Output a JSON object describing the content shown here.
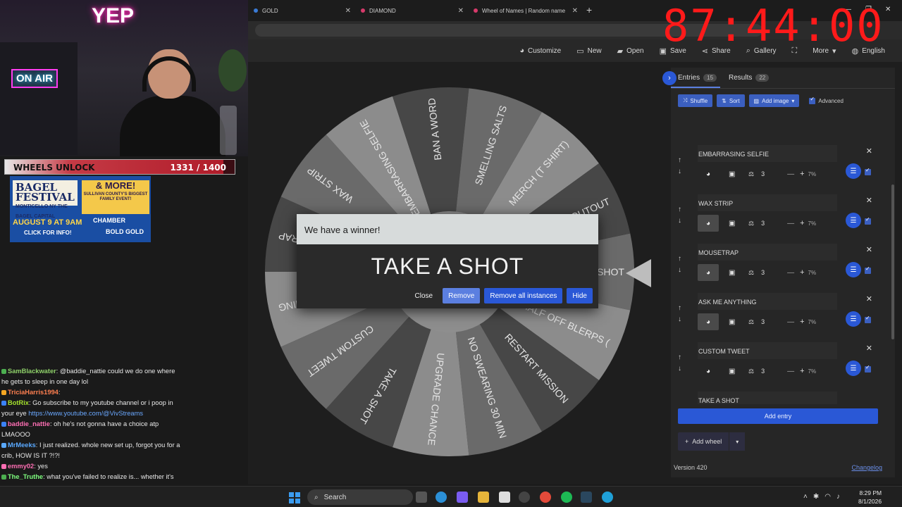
{
  "browser": {
    "tabs": [
      {
        "label": "GOLD",
        "color": "#3a7bd5"
      },
      {
        "label": "DIAMOND",
        "color": "#d73a6b"
      },
      {
        "label": "Wheel of Names | Random name",
        "color": "#d73a6b"
      }
    ],
    "new_tab": "+"
  },
  "timer": "87:44:00",
  "toolbar": {
    "customize": "Customize",
    "new": "New",
    "open": "Open",
    "save": "Save",
    "share": "Share",
    "gallery": "Gallery",
    "more": "More",
    "language": "English"
  },
  "wheel": {
    "segments": [
      "TAKE A SHOT",
      "HALF OFF BLERPS (",
      "RESTART MISSION",
      "NO SWEARING 30 MIN",
      "UPGRADE CHANCE",
      "TAKE A SHOT",
      "CUSTOM TWEET",
      "ASK ME ANYTHING",
      "MOUSETRAP",
      "WAX STRIP",
      "EMBARRASING SELFIE",
      "BAN A WORD",
      "SMELLING SALTS",
      "MERCH (T SHIRT)",
      "SHOUTOUT"
    ]
  },
  "modal": {
    "title": "We have a winner!",
    "winner": "TAKE A SHOT",
    "close": "Close",
    "remove": "Remove",
    "remove_all": "Remove all instances",
    "hide": "Hide"
  },
  "panel": {
    "tab_entries": "Entries",
    "entries_count": "15",
    "tab_results": "Results",
    "results_count": "22",
    "shuffle": "Shuffle",
    "sort": "Sort",
    "add_image": "Add image",
    "advanced": "Advanced",
    "entries": [
      {
        "name": "",
        "weight": "3",
        "pct": "7%"
      },
      {
        "name": "EMBARRASING SELFIE",
        "weight": "3",
        "pct": "7%"
      },
      {
        "name": "WAX STRIP",
        "weight": "3",
        "pct": "7%"
      },
      {
        "name": "MOUSETRAP",
        "weight": "3",
        "pct": "7%"
      },
      {
        "name": "ASK ME ANYTHING",
        "weight": "3",
        "pct": "7%"
      },
      {
        "name": "CUSTOM TWEET",
        "weight": "3",
        "pct": "7%"
      },
      {
        "name": "TAKE A SHOT",
        "weight": "",
        "pct": ""
      }
    ],
    "add_entry": "Add entry",
    "add_wheel": "Add wheel",
    "version": "Version 420",
    "changelog": "Changelog"
  },
  "stream": {
    "neon_sign": "YEP",
    "on_air": "ON AIR",
    "unlock_label": "WHEELS UNLOCK",
    "unlock_count": "1331 / 1400",
    "unlock_fraction": 0.9507
  },
  "ad": {
    "title": "BAGEL FESTIVAL",
    "subtitle": "MONTICELLO NY THE BAGEL CAPITAL",
    "more": "& MORE!",
    "more_sub": "SULLIVAN COUNTY'S BIGGEST FAMILY EVENT!",
    "date": "AUGUST 9 AT 9AM",
    "cta": "CLICK FOR INFO!",
    "sponsor1": "CHAMBER",
    "sponsor2": "BOLD GOLD"
  },
  "chat": [
    {
      "user": "SamBlackwater",
      "color": "#8fd16a",
      "text": ": @baddie_nattie could we do one where he gets to sleep in one day lol"
    },
    {
      "user": "TriciaHarris1994",
      "color": "#ff7f50",
      "text": ":"
    },
    {
      "user": "BotRix",
      "color": "#a6e22e",
      "text": ": Go subscribe to my youtube channel or i poop in your eye ",
      "link": "https://www.youtube.com/@VivStreams"
    },
    {
      "user": "baddie_nattie",
      "color": "#ff6fb4",
      "text": ": oh he's not gonna have a choice atp LMAOOO"
    },
    {
      "user": "MrMeeks",
      "color": "#5aa9ff",
      "text": ": I just realized. whole new set up, forgot you for a crib, HOW IS IT ?!?!"
    },
    {
      "user": "emmy02",
      "color": "#ff6fb4",
      "text": ": yes"
    },
    {
      "user": "The_Truthe",
      "color": "#7fff7f",
      "text": ": what you've failed to realize is... whether it's my shot or someone else... chat will waterboard you with Tito's by nights end"
    }
  ],
  "taskbar": {
    "search": "Search",
    "time": "8:29 PM",
    "date": "8/1/2026"
  }
}
